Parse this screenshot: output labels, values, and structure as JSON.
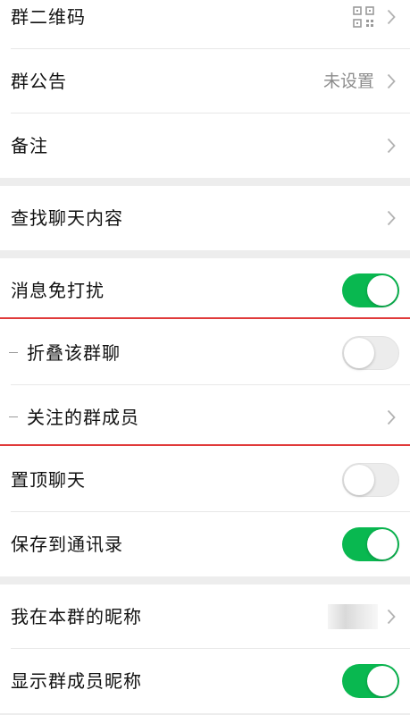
{
  "sections": {
    "group_qr_label": "群二维码",
    "group_notice_label": "群公告",
    "group_notice_value": "未设置",
    "remark_label": "备注",
    "search_chat_label": "查找聊天内容",
    "mute_label": "消息免打扰",
    "mute_on": true,
    "fold_chat_label": "折叠该群聊",
    "fold_chat_on": false,
    "followed_members_label": "关注的群成员",
    "pin_chat_label": "置顶聊天",
    "pin_chat_on": false,
    "save_contacts_label": "保存到通讯录",
    "save_contacts_on": true,
    "my_nickname_label": "我在本群的昵称",
    "show_nicknames_label": "显示群成员昵称",
    "show_nicknames_on": true
  },
  "colors": {
    "toggle_on": "#09b850",
    "highlight_line": "#e03a3a",
    "page_background": "#ededed"
  },
  "icons": [
    "qr-code-icon",
    "chevron-right-icon"
  ]
}
